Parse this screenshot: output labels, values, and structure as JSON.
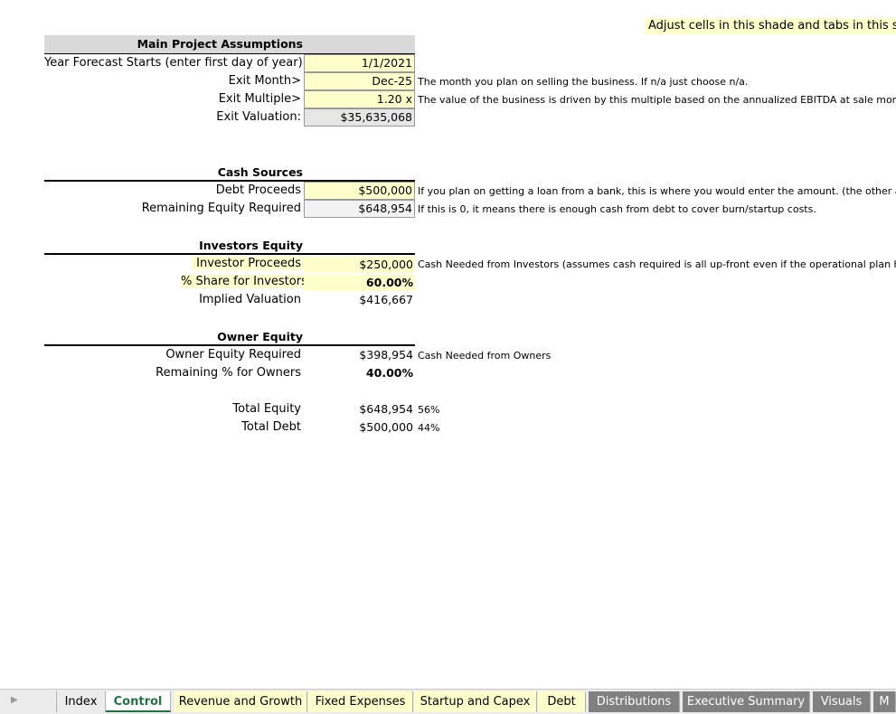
{
  "legend_note": "Adjust cells in this shade and tabs in this sha",
  "main": {
    "header": "Main Project Assumptions",
    "rows": [
      {
        "label": "Year Forecast Starts (enter first day of year)",
        "value": "1/1/2021",
        "note": ""
      },
      {
        "label": "Exit Month>",
        "value": "Dec-25",
        "note": "The month you plan on selling the business. If n/a just choose n/a."
      },
      {
        "label": "Exit Multiple>",
        "value": "1.20 x",
        "note": "The value of the business is driven by this multiple based on the annualized EBITDA at sale month"
      },
      {
        "label": "Exit Valuation:",
        "value": "$35,635,068",
        "note": ""
      }
    ]
  },
  "cash_sources": {
    "header": "Cash Sources",
    "rows": [
      {
        "label": "Debt Proceeds",
        "value": "$500,000",
        "note": "If you plan on getting a loan from a bank, this is where you would enter the amount. (the other as"
      },
      {
        "label": "Remaining Equity Required",
        "value": "$648,954",
        "note": "If this is 0, it means there is enough cash from debt to cover burn/startup costs."
      }
    ]
  },
  "investors_equity": {
    "header": "Investors Equity",
    "rows": [
      {
        "label": "Investor Proceeds",
        "value": "$250,000",
        "note": "Cash Needed from Investors (assumes cash required is all up-front even if the operational plan h"
      },
      {
        "label": "% Share for Investors",
        "value": "60.00%",
        "note": ""
      },
      {
        "label": "Implied Valuation",
        "value": "$416,667",
        "note": ""
      }
    ]
  },
  "owner_equity": {
    "header": "Owner Equity",
    "rows": [
      {
        "label": "Owner Equity Required",
        "value": "$398,954",
        "note": "Cash Needed from Owners"
      },
      {
        "label": "Remaining % for Owners",
        "value": "40.00%",
        "note": ""
      }
    ]
  },
  "totals": {
    "rows": [
      {
        "label": "Total Equity",
        "value": "$648,954",
        "pct": "56%"
      },
      {
        "label": "Total Debt",
        "value": "$500,000",
        "pct": "44%"
      }
    ]
  },
  "tabs": [
    {
      "label": "Index"
    },
    {
      "label": "Control"
    },
    {
      "label": "Revenue and Growth"
    },
    {
      "label": "Fixed Expenses"
    },
    {
      "label": "Startup and Capex"
    },
    {
      "label": "Debt"
    },
    {
      "label": "Distributions"
    },
    {
      "label": "Executive Summary"
    },
    {
      "label": "Visuals"
    },
    {
      "label": "M"
    }
  ],
  "colors": {
    "input_shade": "#ffffcc",
    "tab_grey": "#808080",
    "active_tab_text": "#217346"
  }
}
